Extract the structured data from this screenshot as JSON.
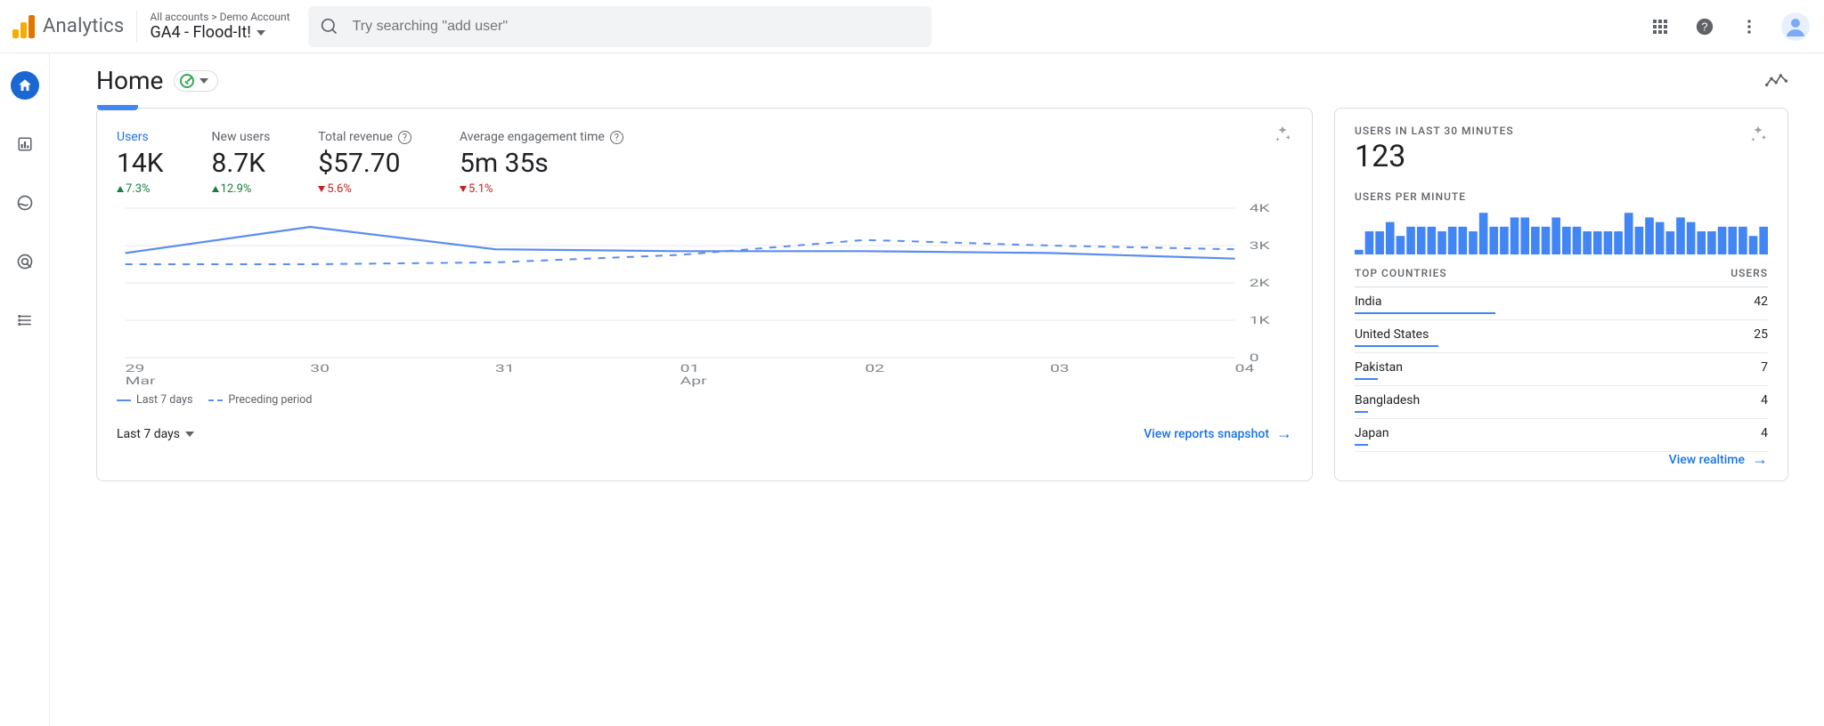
{
  "header": {
    "product": "Analytics",
    "account_path": "All accounts > Demo Account",
    "property": "GA4 - Flood-It!",
    "search_placeholder": "Try searching \"add user\""
  },
  "page": {
    "title": "Home"
  },
  "main_card": {
    "metrics": [
      {
        "label": "Users",
        "value": "14K",
        "delta": "7.3%",
        "dir": "up",
        "help": false,
        "selected": true
      },
      {
        "label": "New users",
        "value": "8.7K",
        "delta": "12.9%",
        "dir": "up",
        "help": false,
        "selected": false
      },
      {
        "label": "Total revenue",
        "value": "$57.70",
        "delta": "5.6%",
        "dir": "down",
        "help": true,
        "selected": false
      },
      {
        "label": "Average engagement time",
        "value": "5m 35s",
        "delta": "5.1%",
        "dir": "down",
        "help": true,
        "selected": false
      }
    ],
    "legend": {
      "current": "Last 7 days",
      "previous": "Preceding period"
    },
    "range_label": "Last 7 days",
    "link": "View reports snapshot"
  },
  "side_card": {
    "title": "USERS IN LAST 30 MINUTES",
    "value": "123",
    "sub": "USERS PER MINUTE",
    "countries_hdr_left": "TOP COUNTRIES",
    "countries_hdr_right": "USERS",
    "countries": [
      {
        "name": "India",
        "users": 42
      },
      {
        "name": "United States",
        "users": 25
      },
      {
        "name": "Pakistan",
        "users": 7
      },
      {
        "name": "Bangladesh",
        "users": 4
      },
      {
        "name": "Japan",
        "users": 4
      }
    ],
    "link": "View realtime"
  },
  "chart_data": {
    "type": "line",
    "title": "Users",
    "xlabel": "",
    "ylabel": "Users",
    "ylim": [
      0,
      4000
    ],
    "y_ticks": [
      0,
      1000,
      2000,
      3000,
      4000
    ],
    "y_tick_labels": [
      "0",
      "1K",
      "2K",
      "3K",
      "4K"
    ],
    "categories": [
      "29",
      "30",
      "31",
      "01",
      "02",
      "03",
      "04"
    ],
    "x_tick_sublabels": [
      "Mar",
      "",
      "",
      "Apr",
      "",
      "",
      ""
    ],
    "series": [
      {
        "name": "Last 7 days",
        "style": "solid",
        "values": [
          2800,
          3500,
          2900,
          2850,
          2850,
          2800,
          2650
        ]
      },
      {
        "name": "Preceding period",
        "style": "dash",
        "values": [
          2500,
          2500,
          2550,
          2750,
          3150,
          3000,
          2900
        ]
      }
    ]
  },
  "bar_data": {
    "type": "bar",
    "ylim": [
      0,
      10
    ],
    "values": [
      1,
      5,
      5,
      7,
      4,
      6,
      6,
      6,
      5,
      6,
      6,
      5,
      9,
      6,
      6,
      8,
      8,
      6,
      6,
      8,
      6,
      6,
      5,
      5,
      5,
      5,
      9,
      6,
      8,
      7,
      5,
      8,
      7,
      5,
      5,
      6,
      6,
      6,
      4,
      6
    ]
  }
}
